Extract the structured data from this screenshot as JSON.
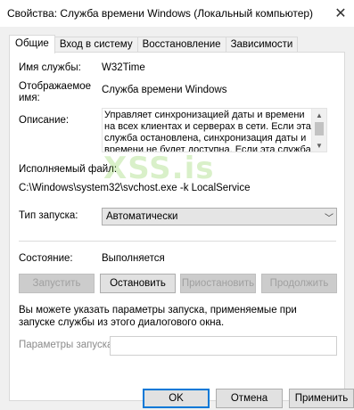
{
  "window": {
    "title": "Свойства: Служба времени Windows (Локальный компьютер)",
    "close_glyph": "✕"
  },
  "tabs": [
    {
      "label": "Общие",
      "active": true
    },
    {
      "label": "Вход в систему",
      "active": false
    },
    {
      "label": "Восстановление",
      "active": false
    },
    {
      "label": "Зависимости",
      "active": false
    }
  ],
  "general": {
    "service_name_label": "Имя службы:",
    "service_name": "W32Time",
    "display_name_label_1": "Отображаемое",
    "display_name_label_2": "имя:",
    "display_name": "Служба времени Windows",
    "description_label": "Описание:",
    "description": "Управляет синхронизацией даты и времени на всех клиентах и серверах в сети. Если эта служба остановлена, синхронизация даты и времени не будет доступна. Если эта служба",
    "executable_label": "Исполняемый файл:",
    "executable_path": "C:\\Windows\\system32\\svchost.exe -k LocalService",
    "startup_type_label": "Тип запуска:",
    "startup_type": "Автоматически",
    "status_label": "Состояние:",
    "status": "Выполняется",
    "watermark": "XSS.is"
  },
  "service_buttons": {
    "start": "Запустить",
    "stop": "Остановить",
    "pause": "Приостановить",
    "resume": "Продолжить"
  },
  "params": {
    "hint": "Вы можете указать параметры запуска, применяемые при запуске службы из этого диалогового окна.",
    "label": "Параметры запуска:",
    "value": ""
  },
  "footer": {
    "ok": "OK",
    "cancel": "Отмена",
    "apply": "Применить"
  },
  "colors": {
    "accent": "#0078d7",
    "dialog_bg": "#f0f0f0",
    "disabled_text": "#a0a0a0"
  }
}
